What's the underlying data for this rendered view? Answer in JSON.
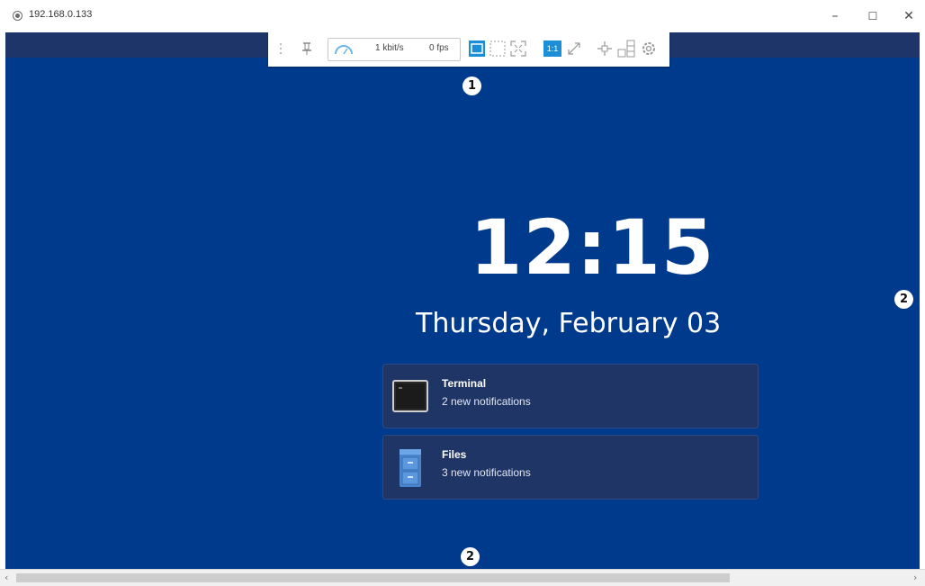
{
  "window": {
    "title": "192.168.0.133",
    "icons": {
      "app": "vnc-viewer-icon",
      "minimize": "minimize-icon",
      "maximize": "maximize-icon",
      "close": "close-icon"
    },
    "minimize_glyph": "–",
    "maximize_glyph": "☐",
    "close_glyph": "✕"
  },
  "toolbar": {
    "icons": [
      "drag-handle-icon",
      "pin-icon",
      "connection-speed-icon",
      "window-mode-icon",
      "full-view-icon",
      "fullscreen-icon",
      "scale-1to1-icon",
      "zoom-fit-icon",
      "move-icon",
      "scale-icon",
      "settings-icon"
    ],
    "bandwidth": "1 kbit/s",
    "fps": "0 fps",
    "scale_label": "1:1",
    "accent_color": "#1a8fd8"
  },
  "annotations": {
    "toolbar_badge": "1",
    "right_badge": "2",
    "bottom_badge": "2"
  },
  "lockscreen": {
    "time": "12:15",
    "date": "Thursday, February 03",
    "background_color": "#003a8d",
    "notifications": [
      {
        "app": "Terminal",
        "text": "2 new notifications",
        "icon": "terminal-icon"
      },
      {
        "app": "Files",
        "text": "3 new notifications",
        "icon": "file-cabinet-icon"
      }
    ]
  },
  "scrollbar": {
    "left_glyph": "‹",
    "right_glyph": "›"
  }
}
